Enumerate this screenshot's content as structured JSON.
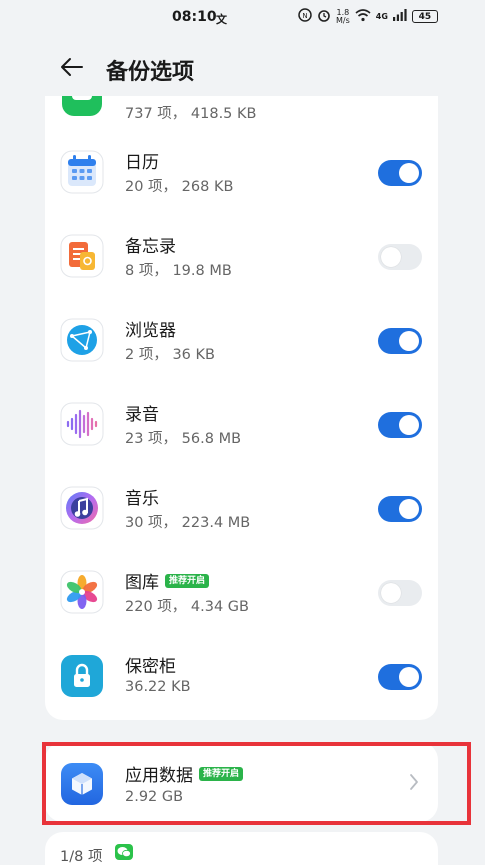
{
  "status_bar": {
    "time": "08:10",
    "net_speed_value": "1.8",
    "net_speed_unit": "M/s",
    "network": "4G",
    "battery": "45"
  },
  "header": {
    "title": "备份选项"
  },
  "items": [
    {
      "name": "",
      "meta": "737 项， 418.5 KB",
      "toggle": null
    },
    {
      "name": "日历",
      "meta": "20 项， 268 KB",
      "toggle": true
    },
    {
      "name": "备忘录",
      "meta": "8 项， 19.8 MB",
      "toggle": false
    },
    {
      "name": "浏览器",
      "meta": "2 项， 36 KB",
      "toggle": true
    },
    {
      "name": "录音",
      "meta": "23 项， 56.8 MB",
      "toggle": true
    },
    {
      "name": "音乐",
      "meta": "30 项， 223.4 MB",
      "toggle": true
    },
    {
      "name": "图库",
      "badge": "推荐开启",
      "meta": "220 项， 4.34 GB",
      "toggle": false
    },
    {
      "name": "保密柜",
      "meta": "36.22 KB",
      "toggle": true
    }
  ],
  "app_data": {
    "name": "应用数据",
    "badge": "推荐开启",
    "meta": "2.92 GB"
  },
  "footer": {
    "count": "1/8 项"
  },
  "colors": {
    "accent": "#1f6fde",
    "badge": "#2bb34a",
    "highlight": "#e8333a"
  }
}
